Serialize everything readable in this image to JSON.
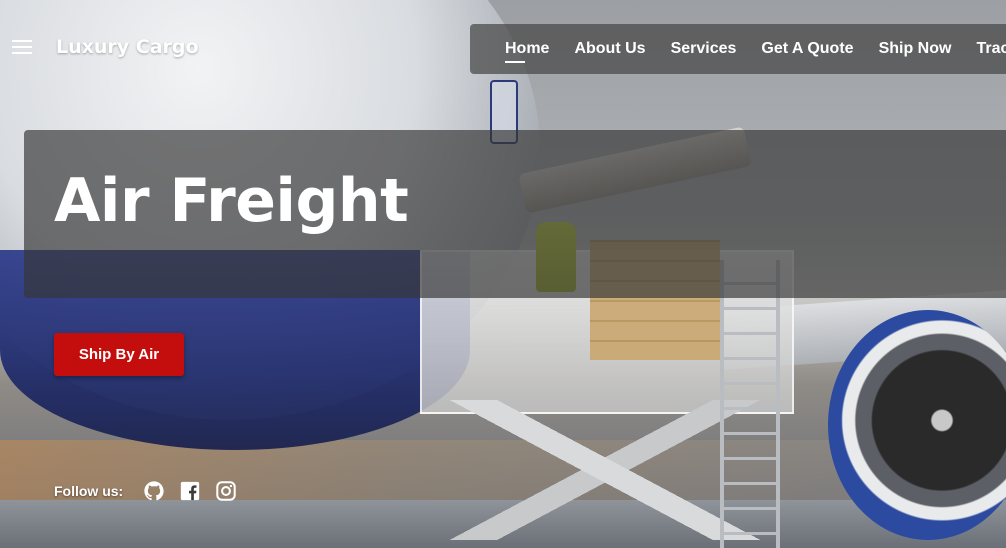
{
  "header": {
    "brand": "Luxury Cargo",
    "menu_icon": "hamburger-menu-icon"
  },
  "nav": {
    "items": [
      {
        "label": "Home",
        "active": true
      },
      {
        "label": "About Us",
        "active": false
      },
      {
        "label": "Services",
        "active": false
      },
      {
        "label": "Get A Quote",
        "active": false
      },
      {
        "label": "Ship Now",
        "active": false
      },
      {
        "label": "Track",
        "active": false
      }
    ]
  },
  "hero": {
    "title": "Air Freight",
    "cta_label": "Ship By Air"
  },
  "social": {
    "label": "Follow us:",
    "icons": [
      "github-icon",
      "facebook-icon",
      "instagram-icon"
    ]
  },
  "colors": {
    "cta": "#c40e0e",
    "overlay": "#373737",
    "text": "#ffffff"
  }
}
